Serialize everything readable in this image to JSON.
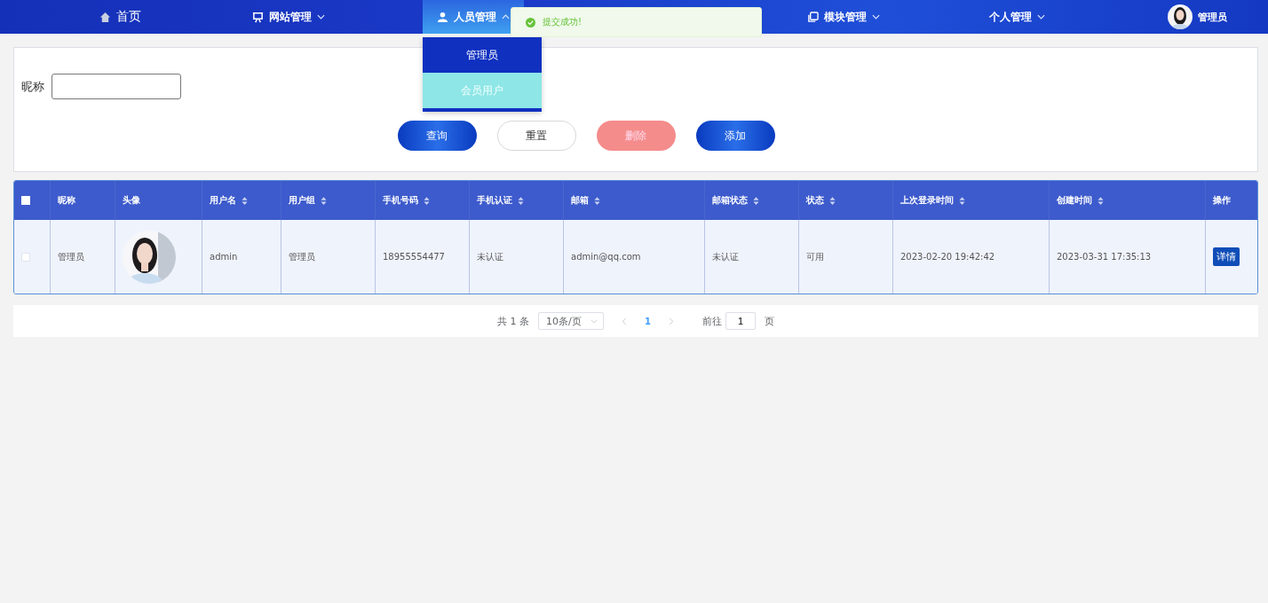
{
  "nav": {
    "items": [
      {
        "label": "首页",
        "has_menu": false,
        "selected": false
      },
      {
        "label": "网站管理",
        "has_menu": true,
        "selected": false
      },
      {
        "label": "人员管理",
        "has_menu": true,
        "selected": true,
        "expanded": true
      },
      {
        "label": "模块管理",
        "has_menu": true,
        "selected": false
      },
      {
        "label": "个人管理",
        "has_menu": true,
        "selected": false
      }
    ],
    "menu": [
      {
        "label": "管理员",
        "selected": false
      },
      {
        "label": "会员用户",
        "selected": true
      }
    ],
    "user": {
      "name": "管理员"
    }
  },
  "toast": {
    "kind": "success",
    "text": "提交成功!"
  },
  "filter": {
    "label": "昵称",
    "buttons": [
      {
        "label": "查询",
        "kind": "primary"
      },
      {
        "label": "重置",
        "kind": "default"
      },
      {
        "label": "删除",
        "kind": "danger"
      },
      {
        "label": "添加",
        "kind": "primary"
      }
    ]
  },
  "table": {
    "select_all": {
      "checked": false
    },
    "columns": [
      {
        "label": "昵称",
        "sortable": false
      },
      {
        "label": "头像",
        "sortable": false
      },
      {
        "label": "用户名",
        "sortable": true
      },
      {
        "label": "用户组",
        "sortable": true
      },
      {
        "label": "手机号码",
        "sortable": true
      },
      {
        "label": "手机认证",
        "sortable": true
      },
      {
        "label": "邮箱",
        "sortable": true
      },
      {
        "label": "邮箱状态",
        "sortable": true
      },
      {
        "label": "状态",
        "sortable": true
      },
      {
        "label": "上次登录时间",
        "sortable": true
      },
      {
        "label": "创建时间",
        "sortable": true
      },
      {
        "label": "操作",
        "sortable": false
      }
    ],
    "rows": [
      {
        "checked": false,
        "cells": [
          {
            "kind": "text",
            "text": "管理员"
          },
          {
            "kind": "avatar"
          },
          {
            "kind": "text",
            "text": "admin"
          },
          {
            "kind": "text",
            "text": "管理员"
          },
          {
            "kind": "text",
            "text": "18955554477"
          },
          {
            "kind": "text",
            "text": "未认证"
          },
          {
            "kind": "text",
            "text": "admin@qq.com"
          },
          {
            "kind": "text",
            "text": "未认证"
          },
          {
            "kind": "text",
            "text": "可用"
          },
          {
            "kind": "text",
            "text": "2023-02-20 19:42:42"
          },
          {
            "kind": "text",
            "text": "2023-03-31 17:35:13"
          },
          {
            "kind": "action",
            "text": "详情"
          }
        ]
      }
    ]
  },
  "pagination": {
    "total": "共 1 条",
    "page_size": "10条/页",
    "pages": [
      {
        "label": "1",
        "selected": true
      }
    ],
    "goto_label": "前往",
    "goto_value": "1",
    "page_unit": "页"
  }
}
